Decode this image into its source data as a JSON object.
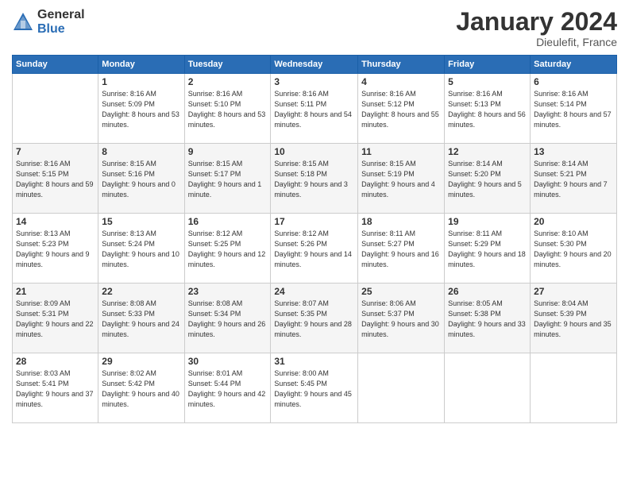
{
  "header": {
    "logo_line1": "General",
    "logo_line2": "Blue",
    "month": "January 2024",
    "location": "Dieulefit, France"
  },
  "weekdays": [
    "Sunday",
    "Monday",
    "Tuesday",
    "Wednesday",
    "Thursday",
    "Friday",
    "Saturday"
  ],
  "weeks": [
    [
      {
        "day": "",
        "sunrise": "",
        "sunset": "",
        "daylight": ""
      },
      {
        "day": "1",
        "sunrise": "Sunrise: 8:16 AM",
        "sunset": "Sunset: 5:09 PM",
        "daylight": "Daylight: 8 hours and 53 minutes."
      },
      {
        "day": "2",
        "sunrise": "Sunrise: 8:16 AM",
        "sunset": "Sunset: 5:10 PM",
        "daylight": "Daylight: 8 hours and 53 minutes."
      },
      {
        "day": "3",
        "sunrise": "Sunrise: 8:16 AM",
        "sunset": "Sunset: 5:11 PM",
        "daylight": "Daylight: 8 hours and 54 minutes."
      },
      {
        "day": "4",
        "sunrise": "Sunrise: 8:16 AM",
        "sunset": "Sunset: 5:12 PM",
        "daylight": "Daylight: 8 hours and 55 minutes."
      },
      {
        "day": "5",
        "sunrise": "Sunrise: 8:16 AM",
        "sunset": "Sunset: 5:13 PM",
        "daylight": "Daylight: 8 hours and 56 minutes."
      },
      {
        "day": "6",
        "sunrise": "Sunrise: 8:16 AM",
        "sunset": "Sunset: 5:14 PM",
        "daylight": "Daylight: 8 hours and 57 minutes."
      }
    ],
    [
      {
        "day": "7",
        "sunrise": "Sunrise: 8:16 AM",
        "sunset": "Sunset: 5:15 PM",
        "daylight": "Daylight: 8 hours and 59 minutes."
      },
      {
        "day": "8",
        "sunrise": "Sunrise: 8:15 AM",
        "sunset": "Sunset: 5:16 PM",
        "daylight": "Daylight: 9 hours and 0 minutes."
      },
      {
        "day": "9",
        "sunrise": "Sunrise: 8:15 AM",
        "sunset": "Sunset: 5:17 PM",
        "daylight": "Daylight: 9 hours and 1 minute."
      },
      {
        "day": "10",
        "sunrise": "Sunrise: 8:15 AM",
        "sunset": "Sunset: 5:18 PM",
        "daylight": "Daylight: 9 hours and 3 minutes."
      },
      {
        "day": "11",
        "sunrise": "Sunrise: 8:15 AM",
        "sunset": "Sunset: 5:19 PM",
        "daylight": "Daylight: 9 hours and 4 minutes."
      },
      {
        "day": "12",
        "sunrise": "Sunrise: 8:14 AM",
        "sunset": "Sunset: 5:20 PM",
        "daylight": "Daylight: 9 hours and 5 minutes."
      },
      {
        "day": "13",
        "sunrise": "Sunrise: 8:14 AM",
        "sunset": "Sunset: 5:21 PM",
        "daylight": "Daylight: 9 hours and 7 minutes."
      }
    ],
    [
      {
        "day": "14",
        "sunrise": "Sunrise: 8:13 AM",
        "sunset": "Sunset: 5:23 PM",
        "daylight": "Daylight: 9 hours and 9 minutes."
      },
      {
        "day": "15",
        "sunrise": "Sunrise: 8:13 AM",
        "sunset": "Sunset: 5:24 PM",
        "daylight": "Daylight: 9 hours and 10 minutes."
      },
      {
        "day": "16",
        "sunrise": "Sunrise: 8:12 AM",
        "sunset": "Sunset: 5:25 PM",
        "daylight": "Daylight: 9 hours and 12 minutes."
      },
      {
        "day": "17",
        "sunrise": "Sunrise: 8:12 AM",
        "sunset": "Sunset: 5:26 PM",
        "daylight": "Daylight: 9 hours and 14 minutes."
      },
      {
        "day": "18",
        "sunrise": "Sunrise: 8:11 AM",
        "sunset": "Sunset: 5:27 PM",
        "daylight": "Daylight: 9 hours and 16 minutes."
      },
      {
        "day": "19",
        "sunrise": "Sunrise: 8:11 AM",
        "sunset": "Sunset: 5:29 PM",
        "daylight": "Daylight: 9 hours and 18 minutes."
      },
      {
        "day": "20",
        "sunrise": "Sunrise: 8:10 AM",
        "sunset": "Sunset: 5:30 PM",
        "daylight": "Daylight: 9 hours and 20 minutes."
      }
    ],
    [
      {
        "day": "21",
        "sunrise": "Sunrise: 8:09 AM",
        "sunset": "Sunset: 5:31 PM",
        "daylight": "Daylight: 9 hours and 22 minutes."
      },
      {
        "day": "22",
        "sunrise": "Sunrise: 8:08 AM",
        "sunset": "Sunset: 5:33 PM",
        "daylight": "Daylight: 9 hours and 24 minutes."
      },
      {
        "day": "23",
        "sunrise": "Sunrise: 8:08 AM",
        "sunset": "Sunset: 5:34 PM",
        "daylight": "Daylight: 9 hours and 26 minutes."
      },
      {
        "day": "24",
        "sunrise": "Sunrise: 8:07 AM",
        "sunset": "Sunset: 5:35 PM",
        "daylight": "Daylight: 9 hours and 28 minutes."
      },
      {
        "day": "25",
        "sunrise": "Sunrise: 8:06 AM",
        "sunset": "Sunset: 5:37 PM",
        "daylight": "Daylight: 9 hours and 30 minutes."
      },
      {
        "day": "26",
        "sunrise": "Sunrise: 8:05 AM",
        "sunset": "Sunset: 5:38 PM",
        "daylight": "Daylight: 9 hours and 33 minutes."
      },
      {
        "day": "27",
        "sunrise": "Sunrise: 8:04 AM",
        "sunset": "Sunset: 5:39 PM",
        "daylight": "Daylight: 9 hours and 35 minutes."
      }
    ],
    [
      {
        "day": "28",
        "sunrise": "Sunrise: 8:03 AM",
        "sunset": "Sunset: 5:41 PM",
        "daylight": "Daylight: 9 hours and 37 minutes."
      },
      {
        "day": "29",
        "sunrise": "Sunrise: 8:02 AM",
        "sunset": "Sunset: 5:42 PM",
        "daylight": "Daylight: 9 hours and 40 minutes."
      },
      {
        "day": "30",
        "sunrise": "Sunrise: 8:01 AM",
        "sunset": "Sunset: 5:44 PM",
        "daylight": "Daylight: 9 hours and 42 minutes."
      },
      {
        "day": "31",
        "sunrise": "Sunrise: 8:00 AM",
        "sunset": "Sunset: 5:45 PM",
        "daylight": "Daylight: 9 hours and 45 minutes."
      },
      {
        "day": "",
        "sunrise": "",
        "sunset": "",
        "daylight": ""
      },
      {
        "day": "",
        "sunrise": "",
        "sunset": "",
        "daylight": ""
      },
      {
        "day": "",
        "sunrise": "",
        "sunset": "",
        "daylight": ""
      }
    ]
  ]
}
